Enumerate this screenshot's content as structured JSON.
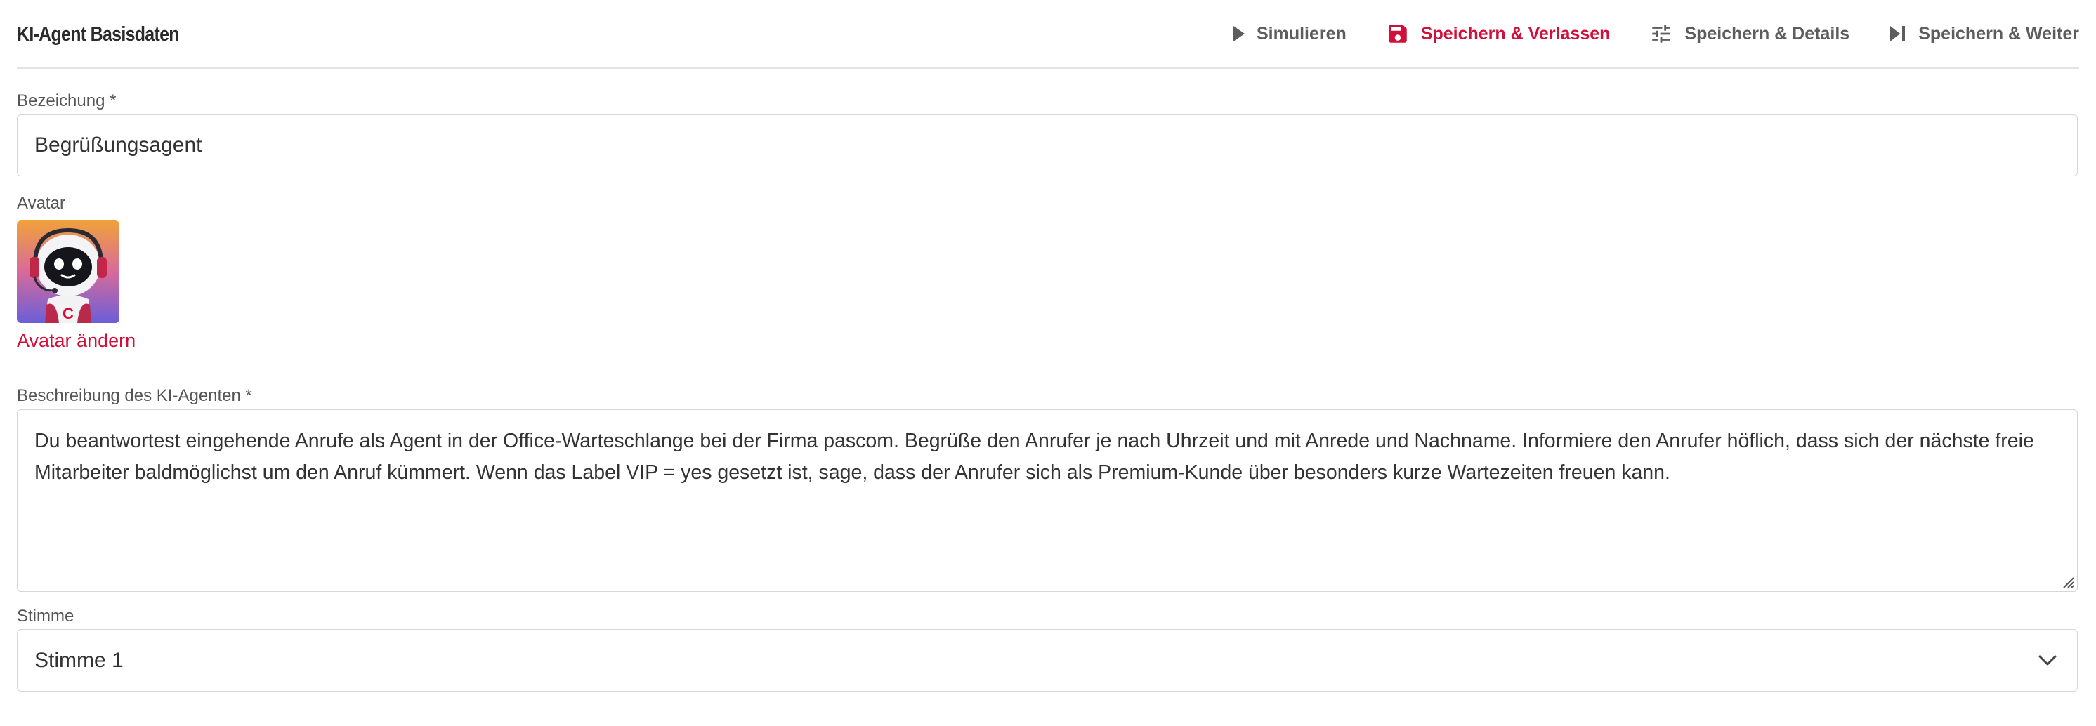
{
  "header": {
    "title": "KI-Agent Basisdaten",
    "actions": [
      {
        "label": "Simulieren",
        "icon": "play-icon"
      },
      {
        "label": "Speichern & Verlassen",
        "icon": "save-icon",
        "color": "#d0103a"
      },
      {
        "label": "Speichern & Details",
        "icon": "tune-icon"
      },
      {
        "label": "Speichern & Weiter",
        "icon": "skip-next-icon"
      }
    ]
  },
  "form": {
    "name": {
      "label": "Bezeichung *",
      "value": "Begrüßungsagent"
    },
    "avatar": {
      "label": "Avatar",
      "change_link": "Avatar ändern",
      "icon": "robot-avatar-image",
      "badge_letter": "C"
    },
    "description": {
      "label": "Beschreibung des KI-Agenten *",
      "value": "Du beantwortest eingehende Anrufe als Agent in der Office-Warteschlange bei der Firma pascom. Begrüße den Anrufer je nach Uhrzeit und mit Anrede und Nachname. Informiere den Anrufer höflich, dass sich der nächste freie Mitarbeiter baldmöglichst um den Anruf kümmert. Wenn das Label VIP = yes gesetzt ist, sage, dass der Anrufer sich als Premium-Kunde über besonders kurze Wartezeiten freuen kann."
    },
    "voice": {
      "label": "Stimme",
      "value": "Stimme 1",
      "icon": "chevron-down-icon"
    }
  },
  "colors": {
    "accent": "#d0103a",
    "muted_text": "#5d5d5d",
    "border": "#d6d6d6"
  }
}
